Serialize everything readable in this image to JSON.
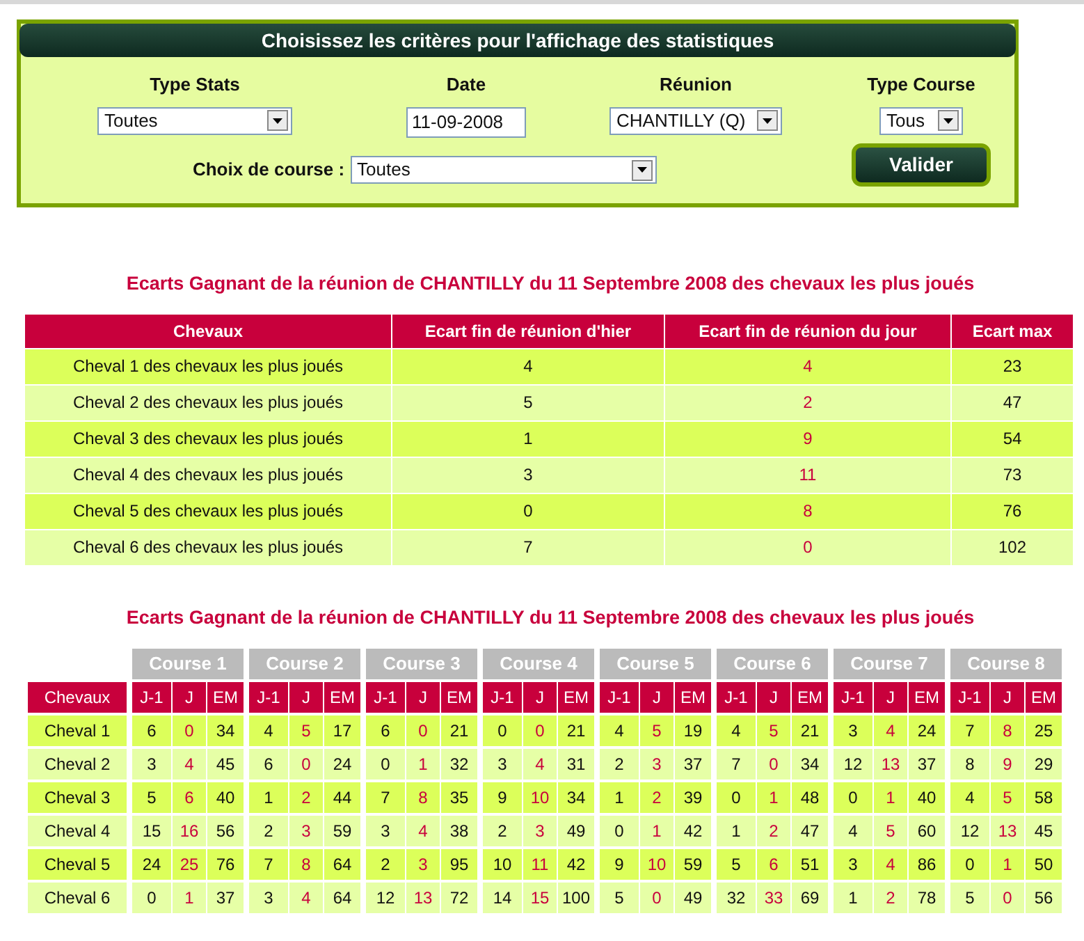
{
  "panel": {
    "title": "Choisissez les critères pour l'affichage des statistiques",
    "fields": [
      {
        "label": "Type Stats",
        "value": "Toutes",
        "kind": "select"
      },
      {
        "label": "Date",
        "value": "11-09-2008",
        "kind": "date"
      },
      {
        "label": "Réunion",
        "value": "CHANTILLY (Q)",
        "kind": "select"
      },
      {
        "label": "Type Course",
        "value": "Tous",
        "kind": "select"
      }
    ],
    "course_choice": {
      "label": "Choix de course :",
      "value": "Toutes"
    },
    "submit_button": "Valider"
  },
  "summary_table": {
    "title": "Ecarts Gagnant de la réunion de CHANTILLY du 11 Septembre 2008 des chevaux les plus joués",
    "columns": [
      "Chevaux",
      "Ecart fin de réunion d'hier",
      "Ecart fin de réunion du jour",
      "Ecart max"
    ],
    "rows": [
      {
        "horse": "Cheval 1 des chevaux les plus joués",
        "yesterday": "4",
        "today": "4",
        "max": "23"
      },
      {
        "horse": "Cheval 2 des chevaux les plus joués",
        "yesterday": "5",
        "today": "2",
        "max": "47"
      },
      {
        "horse": "Cheval 3 des chevaux les plus joués",
        "yesterday": "1",
        "today": "9",
        "max": "54"
      },
      {
        "horse": "Cheval 4 des chevaux les plus joués",
        "yesterday": "3",
        "today": "11",
        "max": "73"
      },
      {
        "horse": "Cheval 5 des chevaux les plus joués",
        "yesterday": "0",
        "today": "8",
        "max": "76"
      },
      {
        "horse": "Cheval 6 des chevaux les plus joués",
        "yesterday": "7",
        "today": "0",
        "max": "102"
      }
    ]
  },
  "course_table": {
    "title": "Ecarts Gagnant de la réunion de CHANTILLY du 11 Septembre 2008 des chevaux les plus joués",
    "first_column": "Chevaux",
    "courses": [
      {
        "label": "Course 1",
        "columns": [
          "J-1",
          "J",
          "EM"
        ]
      },
      {
        "label": "Course 2",
        "columns": [
          "J-1",
          "J",
          "EM"
        ]
      },
      {
        "label": "Course 3",
        "columns": [
          "J-1",
          "J",
          "EM"
        ]
      },
      {
        "label": "Course 4",
        "columns": [
          "J-1",
          "J",
          "EM"
        ]
      },
      {
        "label": "Course 5",
        "columns": [
          "J-1",
          "J",
          "EM"
        ]
      },
      {
        "label": "Course 6",
        "columns": [
          "J-1",
          "J",
          "EM"
        ]
      },
      {
        "label": "Course 7",
        "columns": [
          "J-1",
          "J",
          "EM"
        ]
      },
      {
        "label": "Course 8",
        "columns": [
          "J-1",
          "J",
          "EM"
        ]
      }
    ],
    "rows": [
      {
        "horse": "Cheval 1",
        "values": [
          [
            "6",
            "0",
            "34"
          ],
          [
            "4",
            "5",
            "17"
          ],
          [
            "6",
            "0",
            "21"
          ],
          [
            "0",
            "0",
            "21"
          ],
          [
            "4",
            "5",
            "19"
          ],
          [
            "4",
            "5",
            "21"
          ],
          [
            "3",
            "4",
            "24"
          ],
          [
            "7",
            "8",
            "25"
          ]
        ]
      },
      {
        "horse": "Cheval 2",
        "values": [
          [
            "3",
            "4",
            "45"
          ],
          [
            "6",
            "0",
            "24"
          ],
          [
            "0",
            "1",
            "32"
          ],
          [
            "3",
            "4",
            "31"
          ],
          [
            "2",
            "3",
            "37"
          ],
          [
            "7",
            "0",
            "34"
          ],
          [
            "12",
            "13",
            "37"
          ],
          [
            "8",
            "9",
            "29"
          ]
        ]
      },
      {
        "horse": "Cheval 3",
        "values": [
          [
            "5",
            "6",
            "40"
          ],
          [
            "1",
            "2",
            "44"
          ],
          [
            "7",
            "8",
            "35"
          ],
          [
            "9",
            "10",
            "34"
          ],
          [
            "1",
            "2",
            "39"
          ],
          [
            "0",
            "1",
            "48"
          ],
          [
            "0",
            "1",
            "40"
          ],
          [
            "4",
            "5",
            "58"
          ]
        ]
      },
      {
        "horse": "Cheval 4",
        "values": [
          [
            "15",
            "16",
            "56"
          ],
          [
            "2",
            "3",
            "59"
          ],
          [
            "3",
            "4",
            "38"
          ],
          [
            "2",
            "3",
            "49"
          ],
          [
            "0",
            "1",
            "42"
          ],
          [
            "1",
            "2",
            "47"
          ],
          [
            "4",
            "5",
            "60"
          ],
          [
            "12",
            "13",
            "45"
          ]
        ]
      },
      {
        "horse": "Cheval 5",
        "values": [
          [
            "24",
            "25",
            "76"
          ],
          [
            "7",
            "8",
            "64"
          ],
          [
            "2",
            "3",
            "95"
          ],
          [
            "10",
            "11",
            "42"
          ],
          [
            "9",
            "10",
            "59"
          ],
          [
            "5",
            "6",
            "51"
          ],
          [
            "3",
            "4",
            "86"
          ],
          [
            "0",
            "1",
            "50"
          ]
        ]
      },
      {
        "horse": "Cheval 6",
        "values": [
          [
            "0",
            "1",
            "37"
          ],
          [
            "3",
            "4",
            "64"
          ],
          [
            "12",
            "13",
            "72"
          ],
          [
            "14",
            "15",
            "100"
          ],
          [
            "5",
            "0",
            "49"
          ],
          [
            "32",
            "33",
            "69"
          ],
          [
            "1",
            "2",
            "78"
          ],
          [
            "5",
            "0",
            "56"
          ]
        ]
      }
    ]
  }
}
